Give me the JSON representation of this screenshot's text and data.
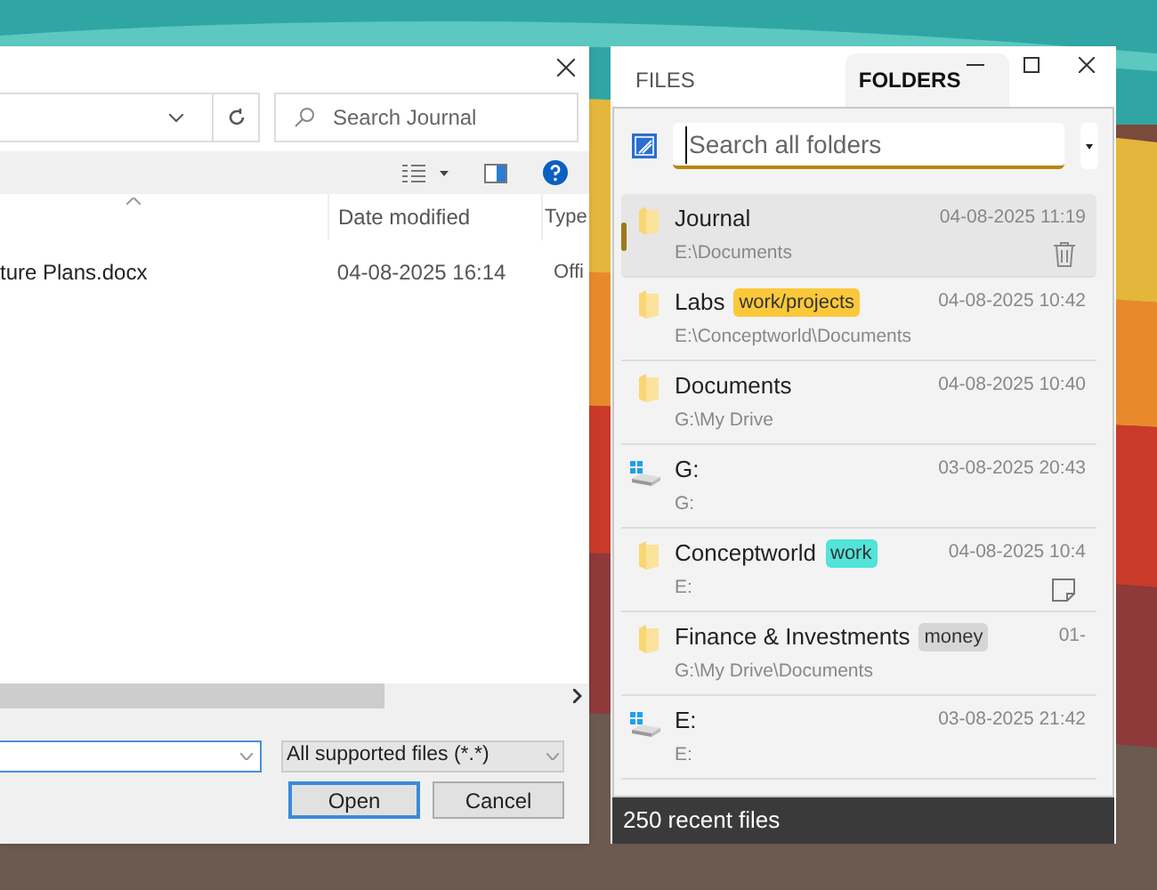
{
  "dialog": {
    "search": {
      "placeholder": "Search Journal"
    },
    "columns": [
      {
        "label": "Date modified"
      },
      {
        "label": "Type"
      }
    ],
    "files": [
      {
        "name": "ture Plans.docx",
        "date": "04-08-2025 16:14",
        "type": "Offi"
      }
    ],
    "filter": {
      "value": "All supported files (*.*)"
    },
    "buttons": [
      {
        "label": "Open",
        "default": true
      },
      {
        "label": "Cancel",
        "default": false
      }
    ]
  },
  "panel": {
    "tabs": [
      {
        "label": "FILES",
        "selected": false
      },
      {
        "label": "FOLDERS",
        "selected": true
      }
    ],
    "search": {
      "placeholder": "Search all folders"
    },
    "items": [
      {
        "kind": "folder",
        "name": "Journal",
        "date": "04-08-2025 11:19",
        "path": "E:\\Documents",
        "selected": true,
        "has_note": false
      },
      {
        "kind": "folder",
        "name": "Labs",
        "tag": {
          "label": "work/projects",
          "color": "#fbc83a"
        },
        "date": "04-08-2025 10:42",
        "path": "E:\\Conceptworld\\Documents",
        "selected": false,
        "has_note": false
      },
      {
        "kind": "folder",
        "name": "Documents",
        "date": "04-08-2025 10:40",
        "path": "G:\\My Drive",
        "selected": false,
        "has_note": false
      },
      {
        "kind": "drive",
        "name": "G:",
        "date": "03-08-2025 20:43",
        "path": "G:",
        "selected": false,
        "has_note": false
      },
      {
        "kind": "folder",
        "name": "Conceptworld",
        "tag": {
          "label": "work",
          "color": "#52e3d9"
        },
        "date": "04-08-2025 10:4",
        "path": "E:",
        "selected": false,
        "has_note": true
      },
      {
        "kind": "folder",
        "name": "Finance & Investments",
        "tag": {
          "label": "money",
          "color": "#d6d6d6"
        },
        "date": "01-",
        "path": "G:\\My Drive\\Documents",
        "selected": false,
        "has_note": false
      },
      {
        "kind": "drive",
        "name": "E:",
        "date": "03-08-2025 21:42",
        "path": "E:",
        "selected": false,
        "has_note": false
      }
    ],
    "status": "250 recent files"
  }
}
